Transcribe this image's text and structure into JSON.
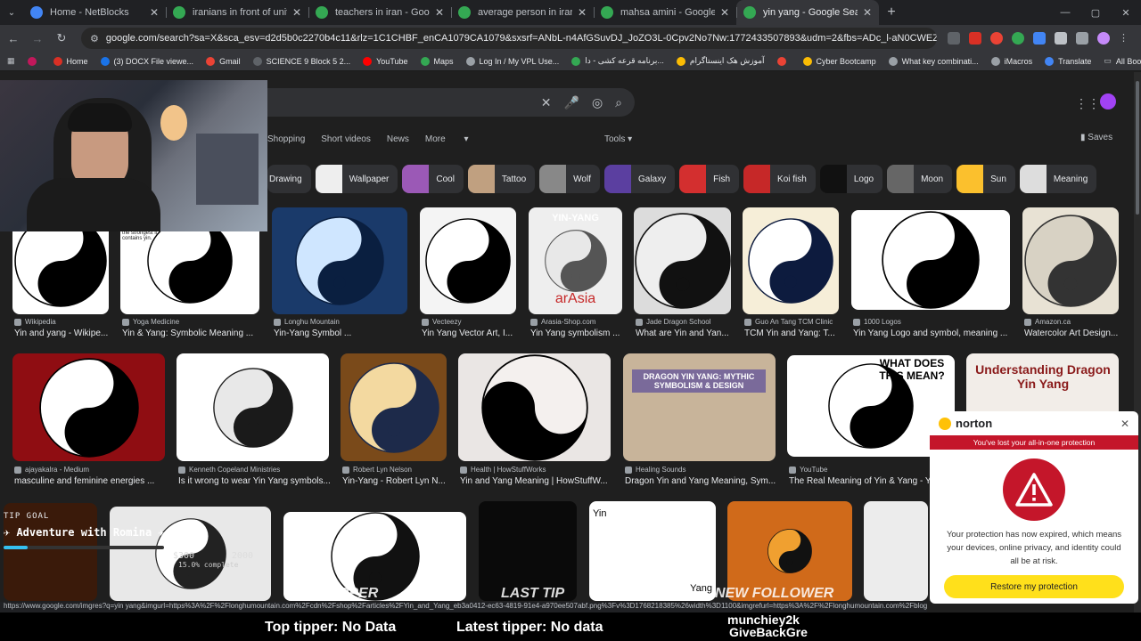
{
  "tabs": [
    {
      "title": "Home - NetBlocks",
      "color": "#4285f4"
    },
    {
      "title": "iranians in front of united states",
      "color": "#34a853"
    },
    {
      "title": "teachers in iran - Google Search",
      "color": "#34a853"
    },
    {
      "title": "average person in iran - Google",
      "color": "#34a853"
    },
    {
      "title": "mahsa amini - Google Search",
      "color": "#34a853"
    },
    {
      "title": "yin yang - Google Search",
      "color": "#34a853",
      "active": true
    }
  ],
  "omnibox": {
    "url": "google.com/search?sa=X&sca_esv=d2d5b0c2270b4c11&rlz=1C1CHBF_enCA1079CA1079&sxsrf=ANbL-n4AfGSuvDJ_JoZO3L-0Cpv2No7Nw:1772433507893&udm=2&fbs=ADc_l-aN0CWEZBOHjofHoaMMDiKpaEWjvZ2P..."
  },
  "bookmarks": [
    {
      "label": "",
      "color": "#c2185b"
    },
    {
      "label": "Home",
      "color": "#d93025"
    },
    {
      "label": "(3) DOCX File viewe...",
      "color": "#1a73e8"
    },
    {
      "label": "Gmail",
      "color": "#ea4335"
    },
    {
      "label": "SCIENCE 9 Block 5 2...",
      "color": "#5f6368"
    },
    {
      "label": "YouTube",
      "color": "#ff0000"
    },
    {
      "label": "Maps",
      "color": "#34a853"
    },
    {
      "label": "Log In / My VPL Use...",
      "color": "#9aa0a6"
    },
    {
      "label": "برنامه قرعه کشی - دا...",
      "color": "#34a853"
    },
    {
      "label": "آموزش هک اینستاگرام",
      "color": "#fbbc04"
    },
    {
      "label": "",
      "color": "#ea4335"
    },
    {
      "label": "Cyber Bootcamp",
      "color": "#fbbc04"
    },
    {
      "label": "What key combinati...",
      "color": "#9aa0a6"
    },
    {
      "label": "iMacros",
      "color": "#9aa0a6"
    },
    {
      "label": "Translate",
      "color": "#4285f4"
    }
  ],
  "all_bookmarks": "All Bookmarks",
  "filters": [
    "Shopping",
    "Short videos",
    "News",
    "More"
  ],
  "tools_label": "Tools",
  "saves_label": "Saves",
  "chips": [
    "Drawing",
    "Wallpaper",
    "Cool",
    "Tattoo",
    "Wolf",
    "Galaxy",
    "Fish",
    "Koi fish",
    "Logo",
    "Moon",
    "Sun",
    "Meaning"
  ],
  "row1": [
    {
      "src": "Wikipedia",
      "cap": "Yin and yang - Wikipe..."
    },
    {
      "src": "Yoga Medicine",
      "cap": "Yin & Yang: Symbolic Meaning ..."
    },
    {
      "src": "Longhu Mountain",
      "cap": "Yin-Yang Symbol ..."
    },
    {
      "src": "Vecteezy",
      "cap": "Yin Yang Vector Art, I..."
    },
    {
      "src": "Arasia-Shop.com",
      "cap": "Yin Yang symbolism ..."
    },
    {
      "src": "Jade Dragon School",
      "cap": "What are Yin and Yan..."
    },
    {
      "src": "Guo An Tang TCM Clinic",
      "cap": "TCM Yin and Yang: T..."
    },
    {
      "src": "1000 Logos",
      "cap": "Yin Yang Logo and symbol, meaning ..."
    },
    {
      "src": "Amazon.ca",
      "cap": "Watercolor Art Design..."
    }
  ],
  "row2": [
    {
      "src": "ajayakalra - Medium",
      "cap": "masculine and feminine energies ..."
    },
    {
      "src": "Kenneth Copeland Ministries",
      "cap": "Is it wrong to wear Yin Yang symbols..."
    },
    {
      "src": "Robert Lyn Nelson",
      "cap": "Yin-Yang - Robert Lyn N..."
    },
    {
      "src": "Health | HowStuffWorks",
      "cap": "Yin and Yang Meaning | HowStuffW..."
    },
    {
      "src": "Healing Sounds",
      "cap": "Dragon Yin and Yang Meaning, Sym..."
    },
    {
      "src": "YouTube",
      "cap": "The Real Meaning of Yin & Yang - Yo..."
    }
  ],
  "thumb_text": {
    "yoga": "When yang is the strongest it contains yin.",
    "arasia_top": "YIN-YANG",
    "arasia_bottom": "arAsia",
    "dragon_title": "DRAGON YIN YANG: MYTHIC SYMBOLISM & DESIGN",
    "what_does": "WHAT DOES THIS MEAN?",
    "understanding": "Understanding Dragon Yin Yang",
    "diagram_yin": "Yin",
    "diagram_yang": "Yang"
  },
  "tip_goal": {
    "label": "TIP GOAL",
    "name": "Adventure with Romina",
    "amount": "$300",
    "goal": "2000",
    "progress_text": "15.0% complete",
    "progress": 0.15
  },
  "norton": {
    "brand": "norton",
    "warning": "You've lost your all-in-one protection",
    "body": "Your protection has now expired, which means your devices, online privacy, and identity could all be at risk.",
    "cta": "Restore my protection"
  },
  "status_url": "https://www.google.com/imgres?q=yin yang&imgurl=https%3A%2F%2Flonghumountain.com%2Fcdn%2Fshop%2Farticles%2FYin_and_Yang_eb3a0412-ec63-4819-91e4-a970ee507abf.png%3Fv%3D1768218385%26width%3D1100&imgrefurl=https%3A%2F%2Flonghumountain.com%2Fblogs%2F",
  "overlay": {
    "top_tipper": "Top tipper: No Data",
    "latest_tipper": "Latest tipper: No data",
    "follower_name": "munchiey2k",
    "follower_sub": "GiveBackGre",
    "tag_top_tipper": "TOP TIPPER",
    "tag_last_tip": "LAST TIP",
    "tag_new_follower": "NEW FOLLOWER"
  }
}
